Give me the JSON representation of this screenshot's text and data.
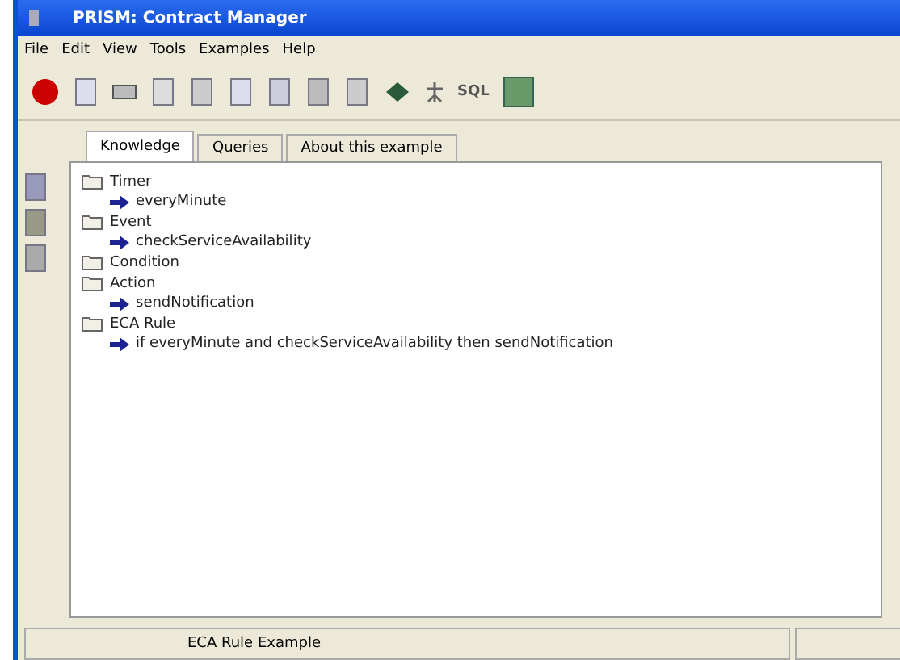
{
  "window": {
    "title": "PRISM: Contract Manager"
  },
  "menu": [
    "File",
    "Edit",
    "View",
    "Tools",
    "Examples",
    "Help"
  ],
  "toolbar": {
    "sql_label": "SQL"
  },
  "tabs": [
    {
      "label": "Knowledge",
      "selected": true
    },
    {
      "label": "Queries",
      "selected": false
    },
    {
      "label": "About this example",
      "selected": false
    }
  ],
  "tree": [
    {
      "label": "Timer",
      "children": [
        {
          "label": "everyMinute"
        }
      ]
    },
    {
      "label": "Event",
      "children": [
        {
          "label": "checkServiceAvailability"
        }
      ]
    },
    {
      "label": "Condition"
    },
    {
      "label": "Action",
      "children": [
        {
          "label": "sendNotification"
        }
      ]
    },
    {
      "label": "ECA Rule",
      "children": [
        {
          "label": "if everyMinute and checkServiceAvailability then sendNotification"
        }
      ]
    }
  ],
  "status_bar": {
    "text": "ECA Rule Example"
  }
}
